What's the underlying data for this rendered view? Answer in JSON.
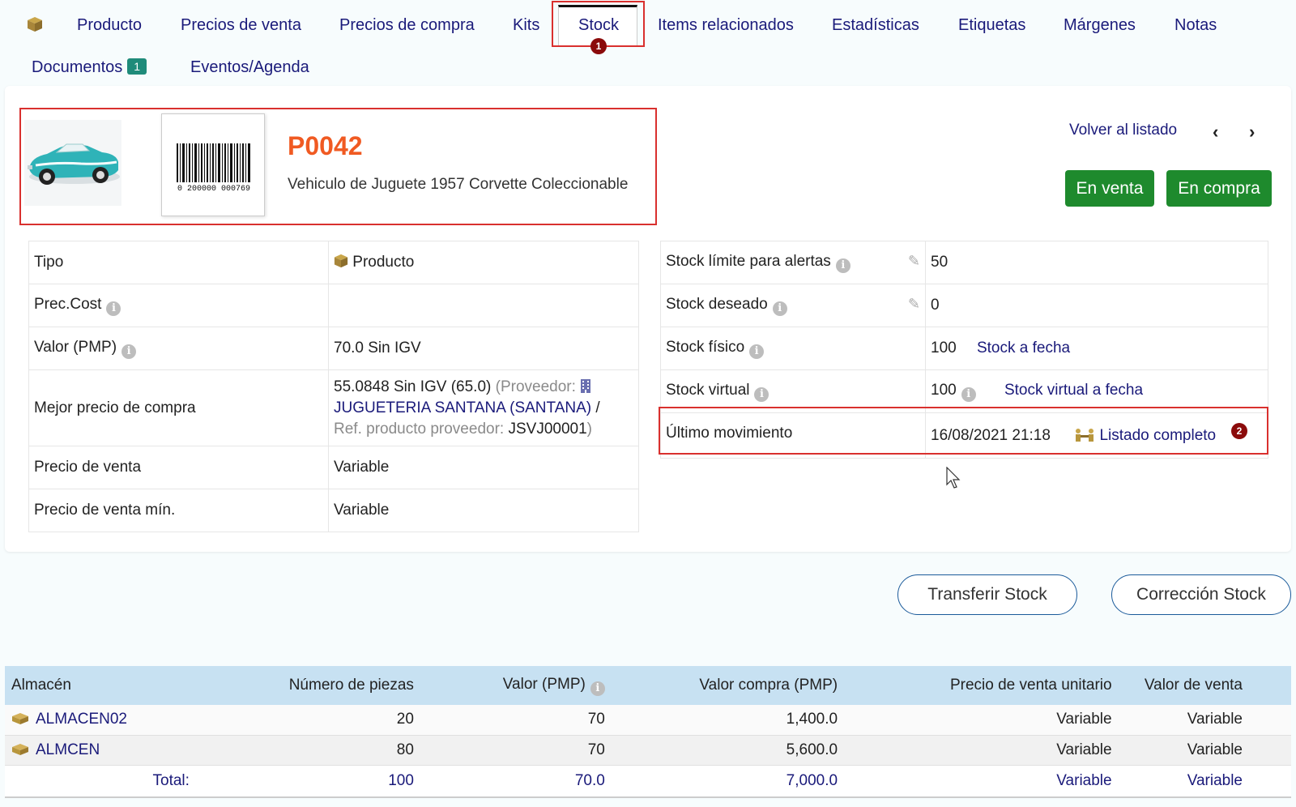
{
  "tabs": {
    "items": [
      {
        "label": "Producto"
      },
      {
        "label": "Precios de venta"
      },
      {
        "label": "Precios de compra"
      },
      {
        "label": "Kits"
      },
      {
        "label": "Stock"
      },
      {
        "label": "Items relacionados"
      },
      {
        "label": "Estadísticas"
      },
      {
        "label": "Etiquetas"
      },
      {
        "label": "Márgenes"
      },
      {
        "label": "Notas"
      },
      {
        "label": "Documentos",
        "badge": "1"
      },
      {
        "label": "Eventos/Agenda"
      }
    ],
    "active": "Stock",
    "active_marker": "1"
  },
  "product": {
    "ref": "P0042",
    "label": "Vehiculo de Juguete 1957 Corvette Coleccionable",
    "barcode_number": "0 200000 000769"
  },
  "nav": {
    "back_label": "Volver al listado",
    "prev_glyph": "‹",
    "next_glyph": "›"
  },
  "status_buttons": {
    "sell": "En venta",
    "buy": "En compra"
  },
  "left_table": {
    "tipo_label": "Tipo",
    "tipo_value": "Producto",
    "prec_cost_label": "Prec.Cost",
    "pmp_label": "Valor (PMP)",
    "pmp_value": "70.0 Sin IGV",
    "best_price_label": "Mejor precio de compra",
    "best_price_value": "55.0848 Sin IGV (65.0)",
    "supplier_prefix": "(Proveedor:",
    "supplier_name": "JUGUETERIA SANTANA (SANTANA)",
    "supplier_sep": "/",
    "supplier_ref_label": "Ref. producto proveedor:",
    "supplier_ref_value": "JSVJ00001",
    "supplier_suffix": ")",
    "sell_price_label": "Precio de venta",
    "sell_price_value": "Variable",
    "min_sell_price_label": "Precio de venta mín.",
    "min_sell_price_value": "Variable"
  },
  "right_table": {
    "alert_label": "Stock límite para alertas",
    "alert_value": "50",
    "desired_label": "Stock deseado",
    "desired_value": "0",
    "physical_label": "Stock físico",
    "physical_value": "100",
    "physical_link": "Stock a fecha",
    "virtual_label": "Stock virtual",
    "virtual_value": "100",
    "virtual_link": "Stock virtual a fecha",
    "last_move_label": "Último movimiento",
    "last_move_value": "16/08/2021 21:18",
    "last_move_link": "Listado completo",
    "last_move_marker": "2"
  },
  "actions": {
    "transfer": "Transferir Stock",
    "correction": "Corrección Stock"
  },
  "warehouse_table": {
    "headers": [
      "Almacén",
      "Número de piezas",
      "Valor (PMP)",
      "Valor compra (PMP)",
      "Precio de venta unitario",
      "Valor de venta"
    ],
    "rows": [
      {
        "name": "ALMACEN02",
        "pieces": "20",
        "pmp": "70",
        "buy_value": "1,400.0",
        "unit_price": "Variable",
        "sell_value": "Variable"
      },
      {
        "name": "ALMCEN",
        "pieces": "80",
        "pmp": "70",
        "buy_value": "5,600.0",
        "unit_price": "Variable",
        "sell_value": "Variable"
      }
    ],
    "total": {
      "label": "Total:",
      "pieces": "100",
      "pmp": "70.0",
      "buy_value": "7,000.0",
      "unit_price": "Variable",
      "sell_value": "Variable"
    }
  },
  "colors": {
    "accent": "#1a1a7a",
    "ref": "#f05a22",
    "green": "#1e8a2d",
    "highlight": "#d9302e",
    "table_header": "#c7e1f2"
  }
}
